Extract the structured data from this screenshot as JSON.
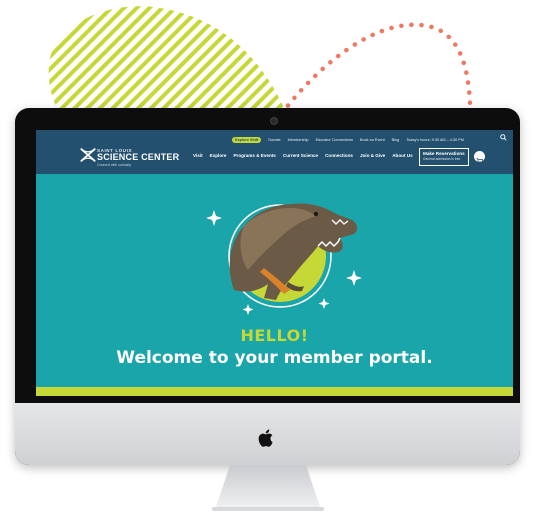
{
  "colors": {
    "teal": "#19a5a9",
    "navy": "#24506f",
    "lime": "#c6d835",
    "coral": "#ef7863"
  },
  "header": {
    "logo": {
      "line1": "SAINT LOUIS",
      "line2": "SCIENCE CENTER",
      "line3": "Connect with curiosity"
    },
    "utility_nav": {
      "pill": "Explore Shift",
      "items": [
        "Donate",
        "Membership",
        "Educator Connections",
        "Book an Event",
        "Blog"
      ],
      "hours": "Today's hours: 9:30 AM – 4:30 PM"
    },
    "main_nav": [
      "Visit",
      "Explore",
      "Programs & Events",
      "Current Science",
      "Connections",
      "Join & Give",
      "About Us"
    ],
    "reservations": {
      "title": "Make Reservations",
      "subtitle": "General admission is free"
    }
  },
  "hero": {
    "hello": "HELLO!",
    "welcome": "Welcome to your member portal."
  },
  "icons": {
    "search": "search-icon",
    "cart": "cart-icon",
    "apple": "apple-logo-icon"
  }
}
